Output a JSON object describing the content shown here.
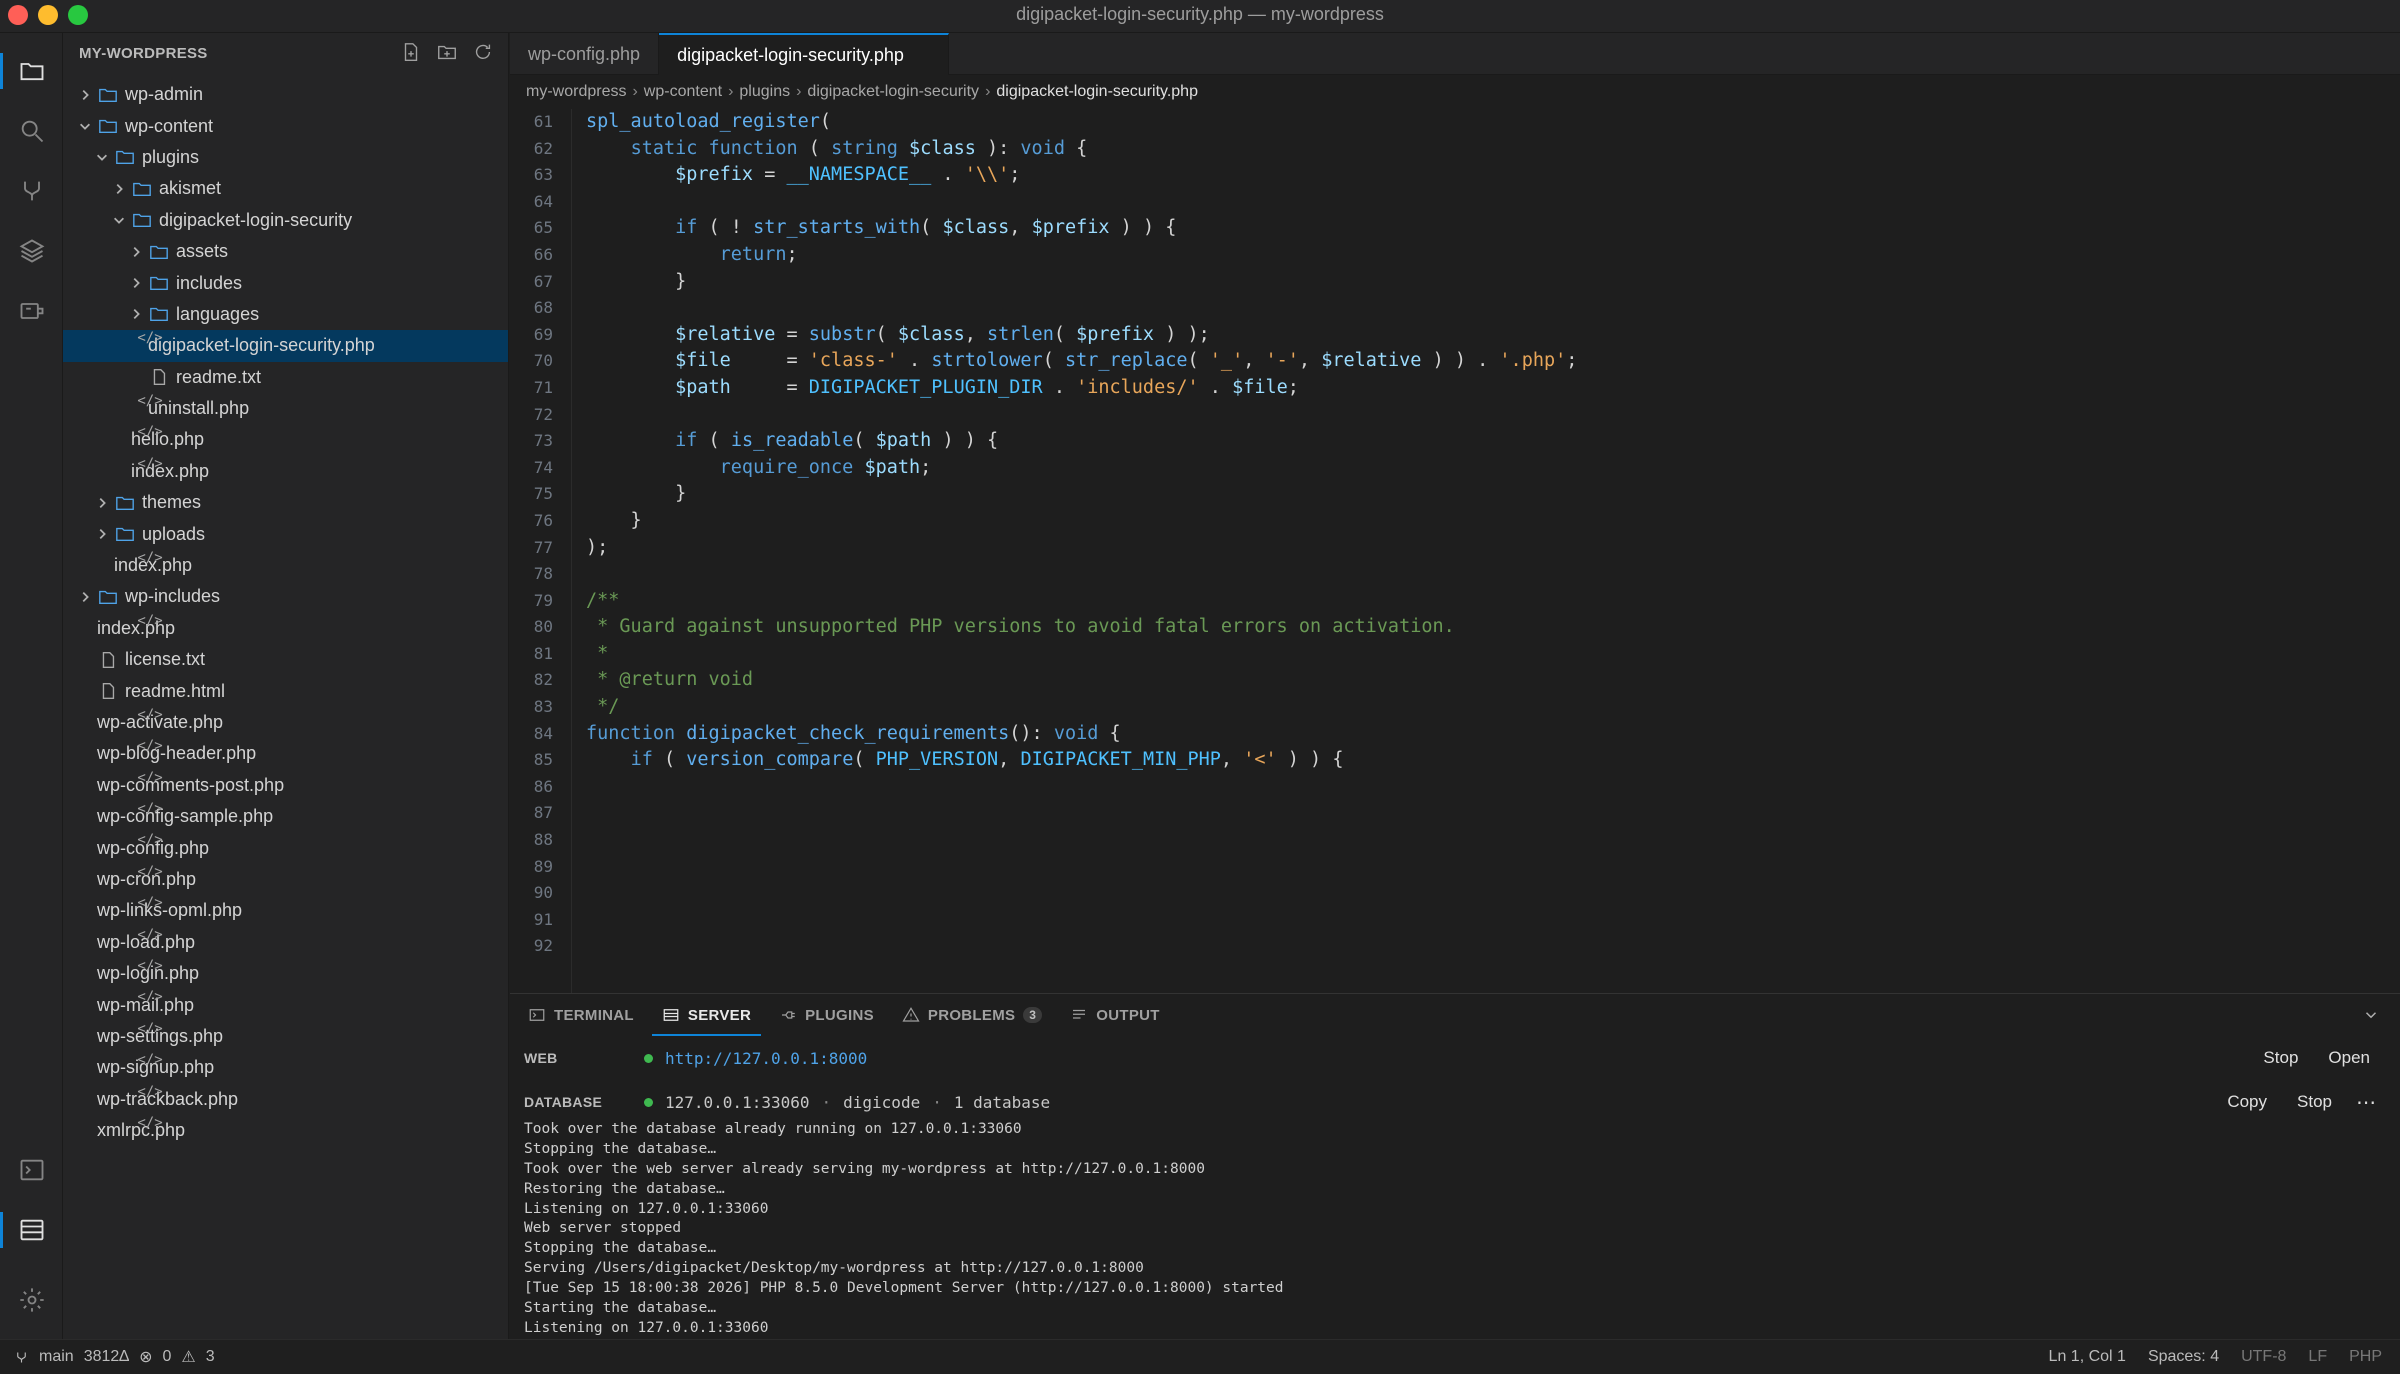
{
  "window": {
    "title": "digipacket-login-security.php — my-wordpress"
  },
  "activity_bar": {
    "items": [
      "explorer-icon",
      "search-icon",
      "source-control-icon",
      "layers-icon",
      "extensions-icon",
      "terminal-icon",
      "server-icon",
      "settings-icon"
    ]
  },
  "sidebar": {
    "header": "MY-WORDPRESS",
    "tree": [
      {
        "label": "wp-admin",
        "type": "folder",
        "depth": 0,
        "expanded": false
      },
      {
        "label": "wp-content",
        "type": "folder",
        "depth": 0,
        "expanded": true
      },
      {
        "label": "plugins",
        "type": "folder",
        "depth": 1,
        "expanded": true
      },
      {
        "label": "akismet",
        "type": "folder",
        "depth": 2,
        "expanded": false
      },
      {
        "label": "digipacket-login-security",
        "type": "folder",
        "depth": 2,
        "expanded": true
      },
      {
        "label": "assets",
        "type": "folder",
        "depth": 3,
        "expanded": false
      },
      {
        "label": "includes",
        "type": "folder",
        "depth": 3,
        "expanded": false
      },
      {
        "label": "languages",
        "type": "folder",
        "depth": 3,
        "expanded": false
      },
      {
        "label": "digipacket-login-security.php",
        "type": "code",
        "depth": 3,
        "selected": true
      },
      {
        "label": "readme.txt",
        "type": "doc",
        "depth": 3
      },
      {
        "label": "uninstall.php",
        "type": "code",
        "depth": 3
      },
      {
        "label": "hello.php",
        "type": "code",
        "depth": 2
      },
      {
        "label": "index.php",
        "type": "code",
        "depth": 2
      },
      {
        "label": "themes",
        "type": "folder",
        "depth": 1,
        "expanded": false
      },
      {
        "label": "uploads",
        "type": "folder",
        "depth": 1,
        "expanded": false
      },
      {
        "label": "index.php",
        "type": "code",
        "depth": 1
      },
      {
        "label": "wp-includes",
        "type": "folder",
        "depth": 0,
        "expanded": false
      },
      {
        "label": "index.php",
        "type": "code",
        "depth": 0
      },
      {
        "label": "license.txt",
        "type": "doc",
        "depth": 0
      },
      {
        "label": "readme.html",
        "type": "doc",
        "depth": 0
      },
      {
        "label": "wp-activate.php",
        "type": "code",
        "depth": 0
      },
      {
        "label": "wp-blog-header.php",
        "type": "code",
        "depth": 0
      },
      {
        "label": "wp-comments-post.php",
        "type": "code",
        "depth": 0
      },
      {
        "label": "wp-config-sample.php",
        "type": "code",
        "depth": 0
      },
      {
        "label": "wp-config.php",
        "type": "code",
        "depth": 0
      },
      {
        "label": "wp-cron.php",
        "type": "code",
        "depth": 0
      },
      {
        "label": "wp-links-opml.php",
        "type": "code",
        "depth": 0
      },
      {
        "label": "wp-load.php",
        "type": "code",
        "depth": 0
      },
      {
        "label": "wp-login.php",
        "type": "code",
        "depth": 0
      },
      {
        "label": "wp-mail.php",
        "type": "code",
        "depth": 0
      },
      {
        "label": "wp-settings.php",
        "type": "code",
        "depth": 0
      },
      {
        "label": "wp-signup.php",
        "type": "code",
        "depth": 0
      },
      {
        "label": "wp-trackback.php",
        "type": "code",
        "depth": 0
      },
      {
        "label": "xmlrpc.php",
        "type": "code",
        "depth": 0
      }
    ]
  },
  "tabs": [
    {
      "label": "wp-config.php",
      "active": false
    },
    {
      "label": "digipacket-login-security.php",
      "active": true
    }
  ],
  "breadcrumb": [
    "my-wordpress",
    "wp-content",
    "plugins",
    "digipacket-login-security",
    "digipacket-login-security.php"
  ],
  "editor": {
    "lines": [
      {
        "n": "61",
        "t": [
          [
            "fn2",
            "spl_autoload_register"
          ],
          [
            "p",
            "("
          ]
        ]
      },
      {
        "n": "62",
        "t": [
          [
            "p",
            "    "
          ],
          [
            "kw",
            "static"
          ],
          [
            "p",
            " "
          ],
          [
            "kw",
            "function"
          ],
          [
            "p",
            " ( "
          ],
          [
            "kw",
            "string"
          ],
          [
            "p",
            " "
          ],
          [
            "var",
            "$class"
          ],
          [
            "p",
            " ): "
          ],
          [
            "kw",
            "void"
          ],
          [
            "p",
            " {"
          ]
        ]
      },
      {
        "n": "63",
        "t": [
          [
            "p",
            "        "
          ],
          [
            "var",
            "$prefix"
          ],
          [
            "p",
            " = "
          ],
          [
            "const",
            "__NAMESPACE__"
          ],
          [
            "p",
            " . "
          ],
          [
            "str",
            "'\\\\'"
          ],
          [
            "p",
            ";"
          ]
        ]
      },
      {
        "n": "64",
        "t": []
      },
      {
        "n": "65",
        "t": [
          [
            "p",
            "        "
          ],
          [
            "kw",
            "if"
          ],
          [
            "p",
            " ( ! "
          ],
          [
            "fn2",
            "str_starts_with"
          ],
          [
            "p",
            "( "
          ],
          [
            "var",
            "$class"
          ],
          [
            "p",
            ", "
          ],
          [
            "var",
            "$prefix"
          ],
          [
            "p",
            " ) ) {"
          ]
        ]
      },
      {
        "n": "66",
        "t": [
          [
            "p",
            "            "
          ],
          [
            "kw",
            "return"
          ],
          [
            "p",
            ";"
          ]
        ]
      },
      {
        "n": "67",
        "t": [
          [
            "p",
            "        }"
          ]
        ]
      },
      {
        "n": "68",
        "t": []
      },
      {
        "n": "69",
        "t": [
          [
            "p",
            "        "
          ],
          [
            "var",
            "$relative"
          ],
          [
            "p",
            " = "
          ],
          [
            "fn2",
            "substr"
          ],
          [
            "p",
            "( "
          ],
          [
            "var",
            "$class"
          ],
          [
            "p",
            ", "
          ],
          [
            "fn2",
            "strlen"
          ],
          [
            "p",
            "( "
          ],
          [
            "var",
            "$prefix"
          ],
          [
            "p",
            " ) );"
          ]
        ]
      },
      {
        "n": "70",
        "t": [
          [
            "p",
            "        "
          ],
          [
            "var",
            "$file"
          ],
          [
            "p",
            "     = "
          ],
          [
            "str",
            "'class-'"
          ],
          [
            "p",
            " . "
          ],
          [
            "fn2",
            "strtolower"
          ],
          [
            "p",
            "( "
          ],
          [
            "fn2",
            "str_replace"
          ],
          [
            "p",
            "( "
          ],
          [
            "str",
            "'_'"
          ],
          [
            "p",
            ", "
          ],
          [
            "str",
            "'-'"
          ],
          [
            "p",
            ", "
          ],
          [
            "var",
            "$relative"
          ],
          [
            "p",
            " ) ) . "
          ],
          [
            "str",
            "'.php'"
          ],
          [
            "p",
            ";"
          ]
        ]
      },
      {
        "n": "71",
        "t": [
          [
            "p",
            "        "
          ],
          [
            "var",
            "$path"
          ],
          [
            "p",
            "     = "
          ],
          [
            "const",
            "DIGIPACKET_PLUGIN_DIR"
          ],
          [
            "p",
            " . "
          ],
          [
            "str",
            "'includes/'"
          ],
          [
            "p",
            " . "
          ],
          [
            "var",
            "$file"
          ],
          [
            "p",
            ";"
          ]
        ]
      },
      {
        "n": "72",
        "t": []
      },
      {
        "n": "73",
        "t": [
          [
            "p",
            "        "
          ],
          [
            "kw",
            "if"
          ],
          [
            "p",
            " ( "
          ],
          [
            "fn2",
            "is_readable"
          ],
          [
            "p",
            "( "
          ],
          [
            "var",
            "$path"
          ],
          [
            "p",
            " ) ) {"
          ]
        ]
      },
      {
        "n": "74",
        "t": [
          [
            "p",
            "            "
          ],
          [
            "kw",
            "require_once"
          ],
          [
            "p",
            " "
          ],
          [
            "var",
            "$path"
          ],
          [
            "p",
            ";"
          ]
        ]
      },
      {
        "n": "75",
        "t": [
          [
            "p",
            "        }"
          ]
        ]
      },
      {
        "n": "76",
        "t": [
          [
            "p",
            "    }"
          ]
        ]
      },
      {
        "n": "77",
        "t": [
          [
            "p",
            ");"
          ]
        ]
      },
      {
        "n": "78",
        "t": []
      },
      {
        "n": "79",
        "t": [
          [
            "com",
            "/**"
          ]
        ]
      },
      {
        "n": "80",
        "t": [
          [
            "com",
            " * Guard against unsupported PHP versions to avoid fatal errors on activation."
          ]
        ]
      },
      {
        "n": "81",
        "t": [
          [
            "com",
            " *"
          ]
        ]
      },
      {
        "n": "82",
        "t": [
          [
            "com",
            " * @return void"
          ]
        ]
      },
      {
        "n": "83",
        "t": [
          [
            "com",
            " */"
          ]
        ]
      },
      {
        "n": "84",
        "t": [
          [
            "kw",
            "function"
          ],
          [
            "p",
            " "
          ],
          [
            "fn2",
            "digipacket_check_requirements"
          ],
          [
            "p",
            "(): "
          ],
          [
            "kw",
            "void"
          ],
          [
            "p",
            " {"
          ]
        ]
      },
      {
        "n": "85",
        "t": [
          [
            "p",
            "    "
          ],
          [
            "kw",
            "if"
          ],
          [
            "p",
            " ( "
          ],
          [
            "fn2",
            "version_compare"
          ],
          [
            "p",
            "( "
          ],
          [
            "const",
            "PHP_VERSION"
          ],
          [
            "p",
            ", "
          ],
          [
            "const",
            "DIGIPACKET_MIN_PHP"
          ],
          [
            "p",
            ", "
          ],
          [
            "str",
            "'<'"
          ],
          [
            "p",
            " ) ) {"
          ]
        ]
      },
      {
        "n": "86",
        "t": []
      },
      {
        "n": "87",
        "t": []
      },
      {
        "n": "88",
        "t": []
      },
      {
        "n": "89",
        "t": []
      },
      {
        "n": "90",
        "t": []
      },
      {
        "n": "91",
        "t": []
      },
      {
        "n": "92",
        "t": []
      }
    ]
  },
  "panel": {
    "tabs": [
      {
        "label": "TERMINAL",
        "icon": "terminal-icon",
        "active": false
      },
      {
        "label": "SERVER",
        "icon": "server-icon",
        "active": true
      },
      {
        "label": "PLUGINS",
        "icon": "plug-icon",
        "active": false
      },
      {
        "label": "PROBLEMS",
        "icon": "warning-icon",
        "active": false,
        "badge": "3"
      },
      {
        "label": "OUTPUT",
        "icon": "list-icon",
        "active": false
      }
    ],
    "web": {
      "label": "WEB",
      "url": "http://127.0.0.1:8000",
      "status_color": "#3fb950",
      "buttons": [
        "Stop",
        "Open"
      ]
    },
    "database": {
      "label": "DATABASE",
      "address": "127.0.0.1:33060",
      "name": "digicode",
      "count": "1 database",
      "status_color": "#3fb950",
      "buttons": [
        "Copy",
        "Stop"
      ]
    },
    "log": [
      "Took over the database already running on 127.0.0.1:33060",
      "Stopping the database…",
      "Took over the web server already serving my-wordpress at http://127.0.0.1:8000",
      "Restoring the database…",
      "Listening on 127.0.0.1:33060",
      "Web server stopped",
      "Stopping the database…",
      "Serving /Users/digipacket/Desktop/my-wordpress at http://127.0.0.1:8000",
      "[Tue Sep 15 18:00:38 2026] PHP 8.5.0 Development Server (http://127.0.0.1:8000) started",
      "Starting the database…",
      "Listening on 127.0.0.1:33060"
    ]
  },
  "statusbar": {
    "branch": "main",
    "sync": "3812∆",
    "errors": "0",
    "warnings": "3",
    "position": "Ln 1, Col 1",
    "spaces": "Spaces: 4",
    "encoding": "UTF-8",
    "eol": "LF",
    "language": "PHP"
  },
  "colors": {
    "accent": "#0e84d8",
    "selection": "#04395e",
    "folder": "#4fa3e8"
  }
}
